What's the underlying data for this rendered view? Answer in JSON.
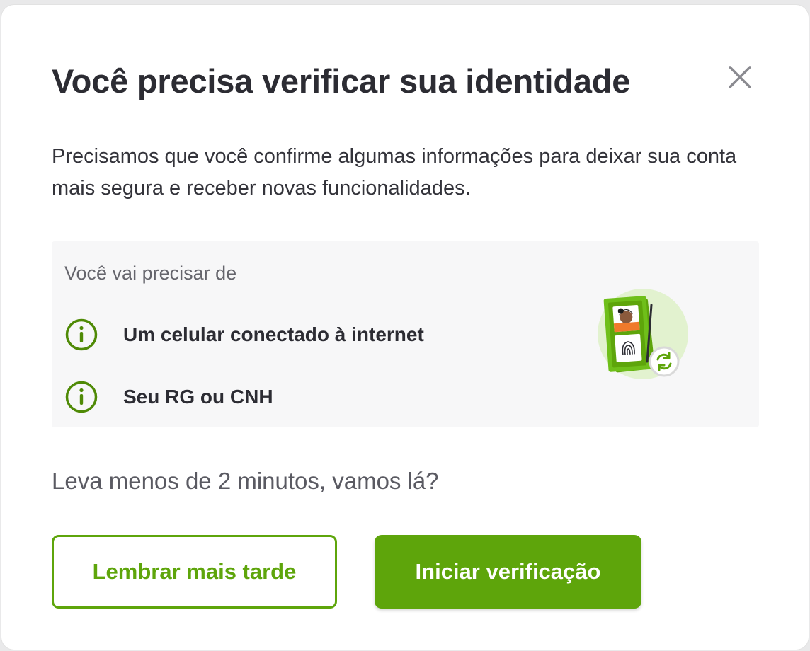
{
  "modal": {
    "title": "Você precisa verificar sua identidade",
    "close_icon": "close-icon",
    "description": "Precisamos que você confirme algumas informações para deixar sua conta mais segura e receber novas funcionalidades."
  },
  "requirements": {
    "heading": "Você vai precisar de",
    "items": [
      {
        "icon": "info-icon",
        "label": "Um celular conectado à internet"
      },
      {
        "icon": "info-icon",
        "label": "Seu RG ou CNH"
      }
    ],
    "illustration_icon": "id-document-verification-illustration"
  },
  "subtext": "Leva menos de 2 minutos, vamos lá?",
  "actions": {
    "remind_later_label": "Lembrar mais tarde",
    "start_verification_label": "Iniciar verificação"
  },
  "colors": {
    "brand_green": "#5ea50b",
    "info_icon_green": "#4f8a06",
    "title_text": "#2c2c33",
    "card_background": "#f7f7f8"
  }
}
